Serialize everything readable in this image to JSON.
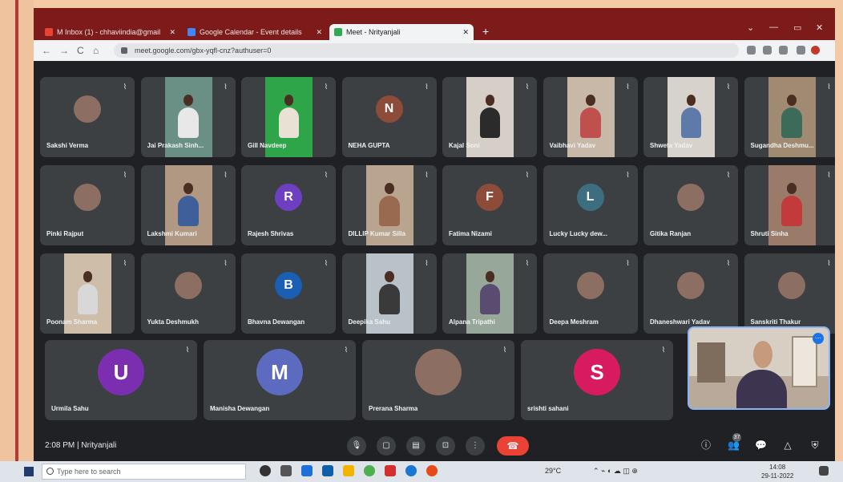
{
  "browser": {
    "tabs": [
      {
        "label": "M  Inbox (1) - chhaviindia@gmail",
        "active": false,
        "favicon_color": "#ea4335"
      },
      {
        "label": "Google Calendar - Event details",
        "active": false,
        "favicon_color": "#4285f4"
      },
      {
        "label": "Meet - Nrityanjali",
        "active": true,
        "favicon_color": "#34a853"
      }
    ],
    "new_tab": "+",
    "url": "meet.google.com/gbx-yqfl-cnz?authuser=0",
    "nav": {
      "back": "←",
      "forward": "→",
      "reload": "C",
      "home": "⌂"
    }
  },
  "meeting": {
    "time": "2:08 PM",
    "separator": "|",
    "name": "Nrityanjali",
    "participant_count": "37"
  },
  "participants_rows": [
    [
      {
        "name": "Sakshi Verma",
        "type": "photo"
      },
      {
        "name": "Jai Prakash Sinh...",
        "type": "video",
        "bg": "#6a8f85",
        "body": "#e8e8e8"
      },
      {
        "name": "Gill Navdeep",
        "type": "video",
        "bg": "#2fa54a",
        "body": "#e9e2d4"
      },
      {
        "name": "NEHA GUPTA",
        "type": "initial",
        "initial": "N",
        "color": "#8d4b3a"
      },
      {
        "name": "Kajal Soni",
        "type": "video",
        "bg": "#d6cfc7",
        "body": "#2b2b2b"
      },
      {
        "name": "Vaibhavi Yadav",
        "type": "video",
        "bg": "#c8b8a8",
        "body": "#c0504d"
      },
      {
        "name": "Shweta Yadav",
        "type": "video",
        "bg": "#d8d2cc",
        "body": "#5e7aa8"
      },
      {
        "name": "Sugandha Deshmu...",
        "type": "video",
        "bg": "#a08a72",
        "body": "#3d6b5a"
      }
    ],
    [
      {
        "name": "Pinki Rajput",
        "type": "photo"
      },
      {
        "name": "Lakshmi Kumari",
        "type": "video",
        "bg": "#b09882",
        "body": "#3f5f9a"
      },
      {
        "name": "Rajesh Shrivas",
        "type": "initial",
        "initial": "R",
        "color": "#6f3fc2"
      },
      {
        "name": "DILLIP Kumar Silla",
        "type": "video",
        "bg": "#b9a48f",
        "body": "#9a6a50"
      },
      {
        "name": "Fatima Nizami",
        "type": "initial",
        "initial": "F",
        "color": "#8d4b3a"
      },
      {
        "name": "Lucky Lucky dew...",
        "type": "initial",
        "initial": "L",
        "color": "#3c6e80"
      },
      {
        "name": "Gitika Ranjan",
        "type": "photo"
      },
      {
        "name": "Shruti Sinha",
        "type": "video",
        "bg": "#9a7b6a",
        "body": "#c23a3a"
      }
    ],
    [
      {
        "name": "Poonam Sharma",
        "type": "video",
        "bg": "#cdbda9",
        "body": "#d8d8d8"
      },
      {
        "name": "Yukta Deshmukh",
        "type": "photo"
      },
      {
        "name": "Bhavna Dewangan",
        "type": "initial",
        "initial": "B",
        "color": "#1a5fb4"
      },
      {
        "name": "Deepika Sahu",
        "type": "video",
        "bg": "#b8c2c8",
        "body": "#3a3a3a"
      },
      {
        "name": "Alpana Tripathi",
        "type": "video",
        "bg": "#97a79a",
        "body": "#5a4b70"
      },
      {
        "name": "Deepa Meshram",
        "type": "photo"
      },
      {
        "name": "Dhaneshwari Yadav",
        "type": "photo"
      },
      {
        "name": "Sanskriti Thakur",
        "type": "photo"
      }
    ],
    [
      {
        "name": "Urmila Sahu",
        "type": "initial",
        "initial": "U",
        "color": "#7b2fb0"
      },
      {
        "name": "Manisha Dewangan",
        "type": "initial",
        "initial": "M",
        "color": "#5c6bc0"
      },
      {
        "name": "Prerana Sharma",
        "type": "photo"
      },
      {
        "name": "srishti sahani",
        "type": "initial",
        "initial": "S",
        "color": "#d81b60"
      }
    ]
  ],
  "self_view": {
    "pin_icon": "⋯"
  },
  "controls": {
    "mic": "🎙",
    "camera": "▢",
    "captions": "▤",
    "present": "⊡",
    "more": "⋮",
    "end_call": "☎"
  },
  "right_controls": [
    "ⓘ",
    "👥",
    "💬",
    "△",
    "⛨"
  ],
  "taskbar": {
    "search_placeholder": "Type here to search",
    "temperature": "29°C",
    "time": "14:08",
    "date": "29-11-2022"
  },
  "colors": {
    "accent": "#8ab4f8",
    "end_call": "#ea4335",
    "tile": "#3c4043"
  }
}
